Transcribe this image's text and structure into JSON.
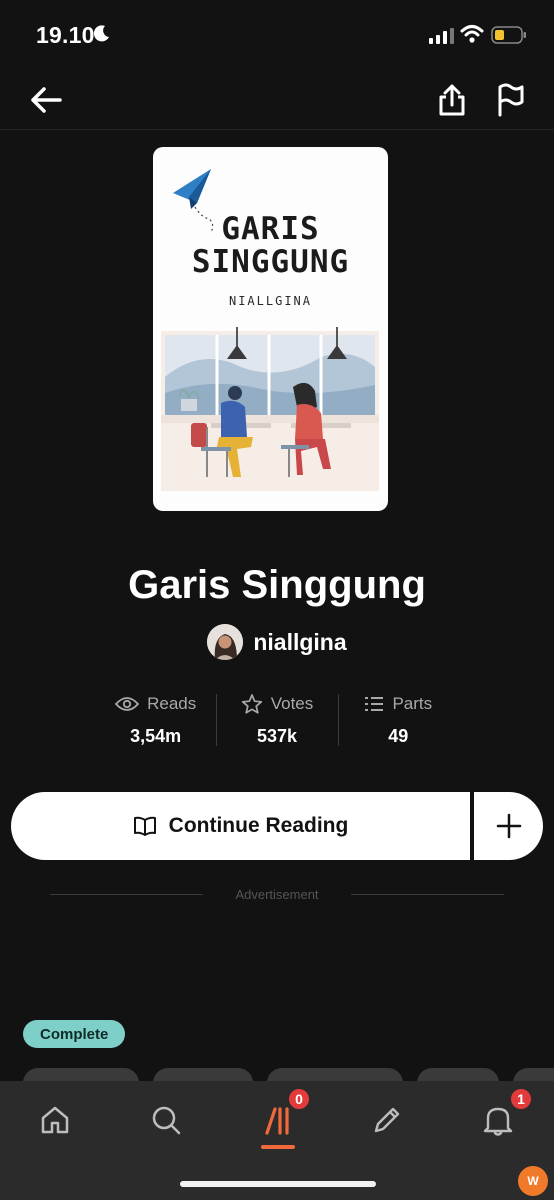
{
  "status_bar": {
    "time": "19.10",
    "icons": [
      "moon-icon",
      "cellular-signal-icon",
      "wifi-icon",
      "battery-icon"
    ],
    "battery_color": "#f2c230"
  },
  "header": {
    "back_icon": "arrow-left-icon",
    "share_icon": "share-upload-icon",
    "report_icon": "flag-icon"
  },
  "cover": {
    "title_line1": "GARIS",
    "title_line2": "SINGGUNG",
    "author": "NIALLGINA"
  },
  "story": {
    "title": "Garis Singgung",
    "author": "niallgina"
  },
  "stats": [
    {
      "label": "Reads",
      "value": "3,54m",
      "icon": "eye-icon"
    },
    {
      "label": "Votes",
      "value": "537k",
      "icon": "star-icon"
    },
    {
      "label": "Parts",
      "value": "49",
      "icon": "list-icon"
    }
  ],
  "actions": {
    "continue_label": "Continue Reading",
    "book_icon": "open-book-icon",
    "add_icon": "plus-icon"
  },
  "ad_label": "Advertisement",
  "status_badge": "Complete",
  "tags": [
    "...",
    "...",
    "...",
    "...",
    "..."
  ],
  "bottom_nav": {
    "items": [
      "home-icon",
      "search-icon",
      "library-icon",
      "write-icon",
      "notifications-icon"
    ],
    "library_badge": "0",
    "notifications_badge": "1"
  },
  "colors": {
    "accent": "#f26a3c",
    "badge": "#e33b3b",
    "complete": "#7ecfc7",
    "background": "#121212"
  }
}
